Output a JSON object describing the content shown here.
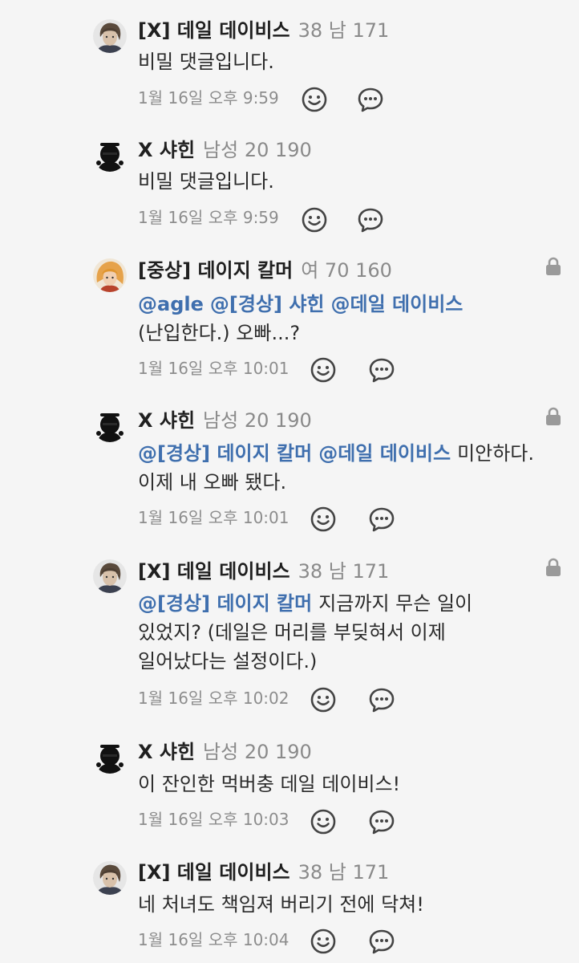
{
  "icons": {
    "smile": "smile-icon",
    "reply": "reply-bubble-icon",
    "lock": "lock-icon"
  },
  "colors": {
    "background": "#f5f5f5",
    "mention": "#3f6fae",
    "meta": "#8a8a8a",
    "icon": "#444444"
  },
  "comments": [
    {
      "name": "[X] 데일 데이비스",
      "meta": "38 남 171",
      "mentions": [],
      "lines": [
        "비밀 댓글입니다."
      ],
      "time": "1월 16일 오후 9:59",
      "locked": false
    },
    {
      "name": "X 샤힌",
      "meta": "남성 20 190",
      "mentions": [],
      "lines": [
        "비밀 댓글입니다."
      ],
      "time": "1월 16일 오후 9:59",
      "locked": false
    },
    {
      "name": "[중상] 데이지 칼머",
      "meta": "여 70 160",
      "mentions": [
        "@agle",
        "@[경상] 샤힌",
        "@데일 데이비스"
      ],
      "lines": [
        "(난입한다.) 오빠...?"
      ],
      "time": "1월 16일 오후 10:01",
      "locked": true
    },
    {
      "name": "X 샤힌",
      "meta": "남성 20 190",
      "mentions": [
        "@[경상] 데이지 칼머",
        "@데일 데이비스"
      ],
      "lines": [
        "미안하다.",
        "이제 내 오빠 됐다."
      ],
      "time": "1월 16일 오후 10:01",
      "locked": true
    },
    {
      "name": "[X] 데일 데이비스",
      "meta": "38 남 171",
      "mentions": [
        "@[경상] 데이지 칼머"
      ],
      "lines": [
        "지금까지 무슨 일이",
        "있었지? (데일은 머리를 부딪혀서 이제",
        "일어났다는 설정이다.)"
      ],
      "time": "1월 16일 오후 10:02",
      "locked": true
    },
    {
      "name": "X 샤힌",
      "meta": "남성 20 190",
      "mentions": [],
      "lines": [
        "이 잔인한 먹버충 데일 데이비스!"
      ],
      "time": "1월 16일 오후 10:03",
      "locked": false
    },
    {
      "name": "[X] 데일 데이비스",
      "meta": "38 남 171",
      "mentions": [],
      "lines": [
        "네 처녀도 책임져 버리기 전에 닥쳐!"
      ],
      "time": "1월 16일 오후 10:04",
      "locked": false
    }
  ]
}
